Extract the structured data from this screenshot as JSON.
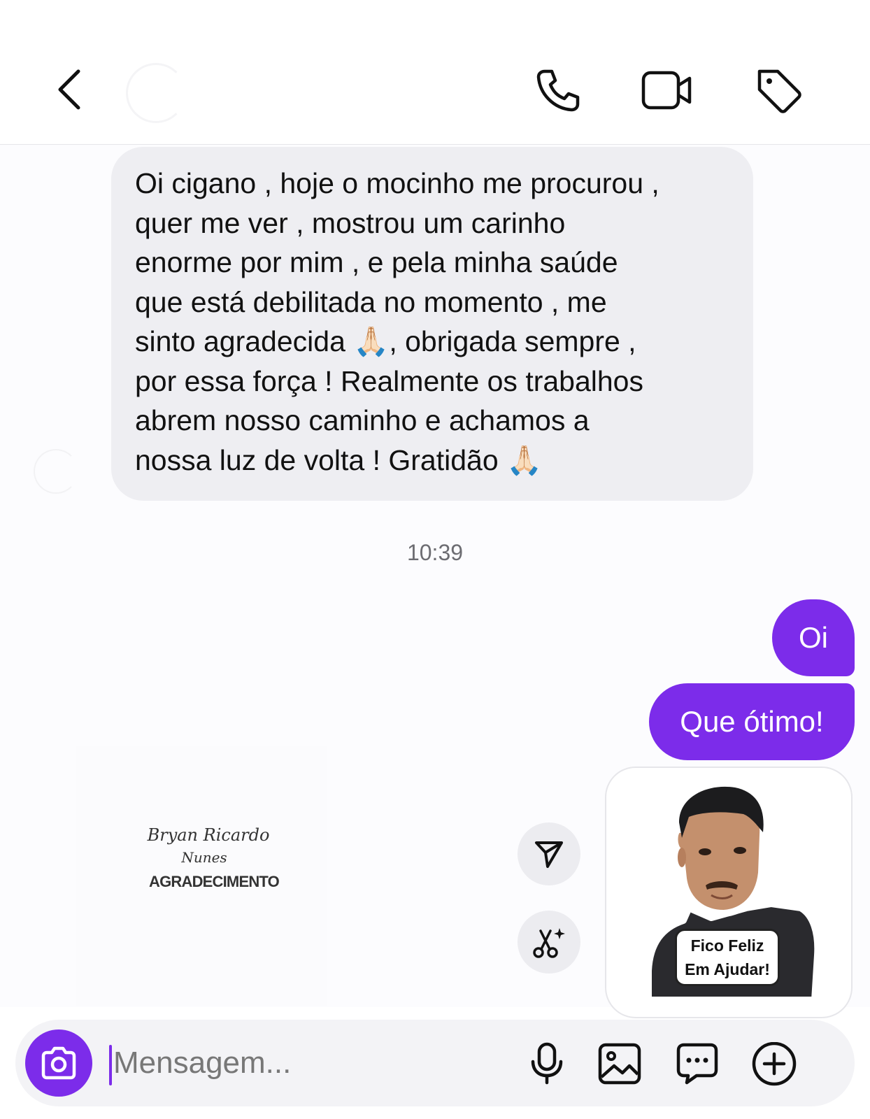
{
  "header": {
    "back": "back-chevron-icon",
    "actions": [
      "phone-icon",
      "video-camera-icon",
      "tag-icon"
    ]
  },
  "conversation": {
    "incoming_message": "Oi cigano , hoje o mocinho me procurou ,\nquer me ver , mostrou um carinho\nenorme por mim , e pela minha saúde\nque está debilitada no momento , me\nsinto agradecida 🙏🏻, obrigada sempre ,\npor essa força ! Realmente os trabalhos\nabrem nosso caminho e achamos a\nnossa luz de volta ! Gratidão 🙏🏻",
    "timestamp": "10:39",
    "outgoing_messages": [
      "Oi",
      "Que ótimo!"
    ],
    "shared_post": {
      "signature_line1": "Bryan Ricardo",
      "signature_line2": "Nunes",
      "title": "AGRADECIMENTO"
    },
    "quick_actions": [
      "send-share-icon",
      "ai-sparkle-scissors-icon"
    ],
    "sticker": {
      "caption_line1": "Fico Feliz",
      "caption_line2": "Em Ajudar!"
    }
  },
  "composer": {
    "placeholder": "Mensagem...",
    "value": "",
    "icons": [
      "camera-icon",
      "microphone-icon",
      "gallery-icon",
      "sticker-chat-icon",
      "plus-circle-icon"
    ]
  },
  "colors": {
    "accent": "#7c2cea",
    "incoming_bubble": "#eeeef2",
    "timestamp": "#6d6d72"
  }
}
